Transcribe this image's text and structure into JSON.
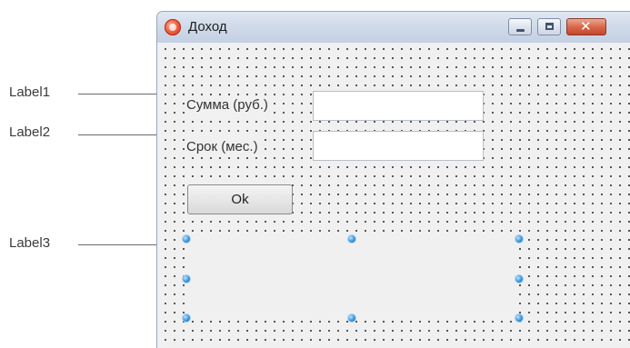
{
  "callouts": [
    {
      "text": "Label1"
    },
    {
      "text": "Label2"
    },
    {
      "text": "Label3"
    }
  ],
  "window": {
    "title": "Доход",
    "app_icon": "app-icon",
    "controls": {
      "minimize_icon": "minimize-icon",
      "maximize_icon": "maximize-icon",
      "close_icon": "close-icon",
      "close_glyph": "✕"
    }
  },
  "form": {
    "label1": "Сумма (руб.)",
    "label2": "Срок (мес.)",
    "input1_value": "",
    "input2_value": "",
    "ok_button": "Ok",
    "label3_text": ""
  },
  "colors": {
    "titlebar": "#cfdae9",
    "form_background": "#f0f0f0",
    "selection_handle": "#3a95dd",
    "close_button": "#d9694b"
  }
}
